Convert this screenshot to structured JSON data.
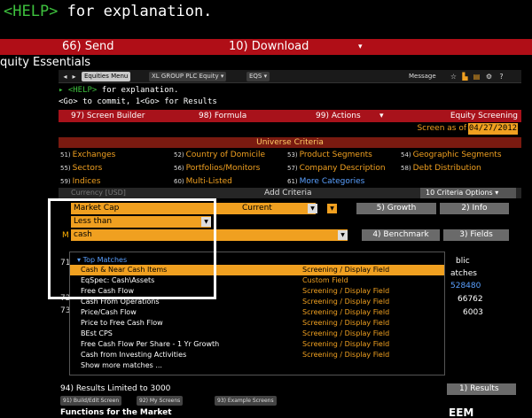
{
  "outer": {
    "help_key": "<HELP>",
    "help_text": " for explanation.",
    "send_label": "66) Send",
    "download_label": "10) Download",
    "download_caret": "▾",
    "title": "quity Essentials"
  },
  "tabs": {
    "nav_prev": "◂",
    "nav_next": "▸",
    "equities_menu": "Equities Menu",
    "company": "XL GROUP PLC Equity ▾",
    "function": "EQS ▾",
    "message": "Message",
    "icons": [
      "star-icon",
      "chart-icon",
      "document-icon",
      "gear-icon",
      "help-icon"
    ]
  },
  "command": {
    "help_key": "<HELP>",
    "help_text": " for explanation.",
    "line2": "<Go> to commit, 1<Go> for Results"
  },
  "toolbar": {
    "screen_builder": "97) Screen Builder",
    "formula": "98) Formula",
    "actions": "99) Actions",
    "actions_caret": "▾",
    "equity_screening": "Equity Screening"
  },
  "screen_as_of": {
    "label": "Screen as of",
    "date": "04/27/2012"
  },
  "universe": {
    "title": "Universe Criteria",
    "items": [
      {
        "num": "51)",
        "label": "Exchanges"
      },
      {
        "num": "52)",
        "label": "Country of Domicile"
      },
      {
        "num": "53)",
        "label": "Product Segments"
      },
      {
        "num": "54)",
        "label": "Geographic Segments"
      },
      {
        "num": "55)",
        "label": "Sectors"
      },
      {
        "num": "56)",
        "label": "Portfolios/Monitors"
      },
      {
        "num": "57)",
        "label": "Company Description"
      },
      {
        "num": "58)",
        "label": "Debt Distribution"
      },
      {
        "num": "59)",
        "label": "Indices"
      },
      {
        "num": "60)",
        "label": "Multi-Listed"
      },
      {
        "num": "61)",
        "label": "More Categories"
      }
    ]
  },
  "add_criteria": {
    "currency": "Currency [USD]",
    "title": "Add Criteria",
    "options_button": "10 Criteria Options ▾",
    "field_value": "Market Cap",
    "period_value": "Current",
    "operator_value": "Less than",
    "search_value": "cash",
    "growth_button": "5) Growth",
    "info_button": "2) Info",
    "benchmark_button": "4) Benchmark",
    "fields_button": "3) Fields",
    "m_label": "M",
    "row_label_71": "71)",
    "row_label_72": "72)",
    "row_label_73": "73)"
  },
  "dropdown": {
    "header": "Top Matches",
    "items": [
      {
        "name": "Cash & Near Cash Items",
        "type": "Screening / Display Field",
        "selected": true
      },
      {
        "name": "EqSpec: Cash\\Assets",
        "type": "Custom Field",
        "selected": false
      },
      {
        "name": "Free Cash Flow",
        "type": "Screening / Display Field",
        "selected": false
      },
      {
        "name": "Cash From Operations",
        "type": "Screening / Display Field",
        "selected": false
      },
      {
        "name": "Price/Cash Flow",
        "type": "Screening / Display Field",
        "selected": false
      },
      {
        "name": "Price to Free Cash Flow",
        "type": "Screening / Display Field",
        "selected": false
      },
      {
        "name": "BEst CPS",
        "type": "Screening / Display Field",
        "selected": false
      },
      {
        "name": "Free Cash Flow Per Share - 1 Yr Growth",
        "type": "Screening / Display Field",
        "selected": false
      },
      {
        "name": "Cash from Investing Activities",
        "type": "Screening / Display Field",
        "selected": false
      },
      {
        "name": "Show more matches ...",
        "type": "",
        "selected": false
      }
    ]
  },
  "right_column": {
    "header_top": "blic",
    "header_bottom": "atches",
    "values": [
      "528480",
      "66762",
      "6003"
    ]
  },
  "results": {
    "limit": "94) Results Limited to 3000",
    "button": "1) Results"
  },
  "bottom_tabs": [
    "91) Build/Edit Screen",
    "92) My Screens",
    "93) Example Screens"
  ],
  "footer": {
    "functions_text": "Functions for the Market",
    "logo": "EEM"
  },
  "colors": {
    "accent": "#f0a020",
    "red": "#b00e17",
    "green": "#3ec23e",
    "blue": "#5aa0ff"
  }
}
